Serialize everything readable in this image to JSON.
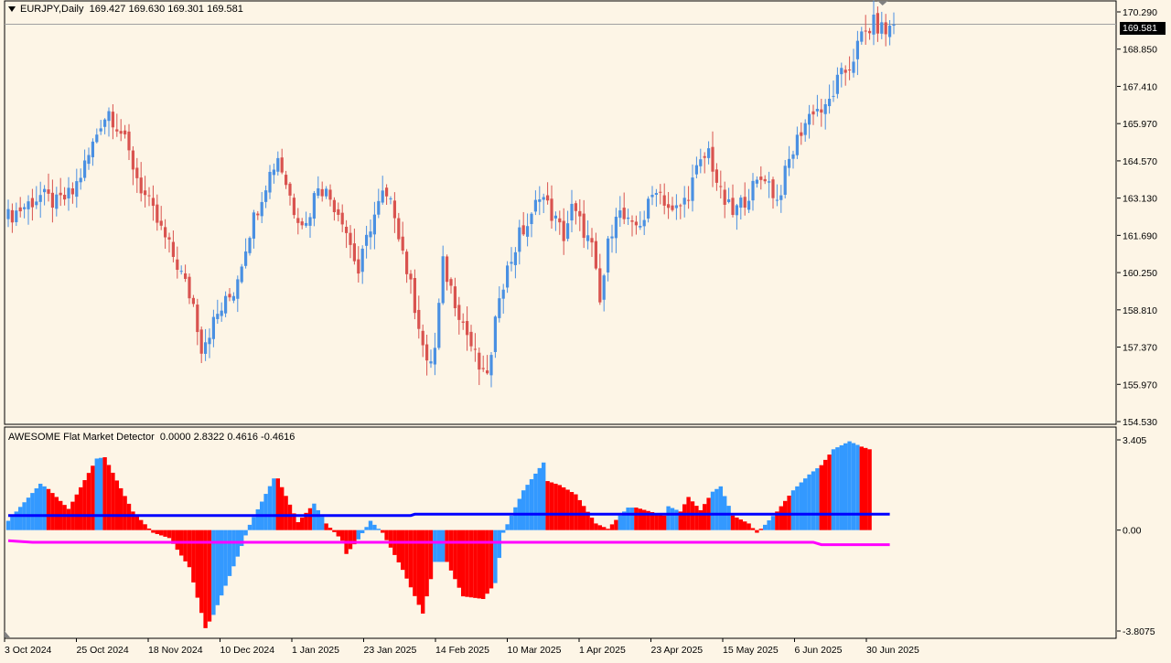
{
  "symbol_line": {
    "symbol": "EURJPY,Daily",
    "open": "169.427",
    "high": "169.630",
    "low": "169.301",
    "close": "169.581"
  },
  "indicator_line": {
    "name": "AWESOME Flat Market Detector",
    "v1": "0.0000",
    "v2": "2.8322",
    "v3": "0.4616",
    "v4": "-0.4616"
  },
  "price_tag": "169.581",
  "price_axis_labels": [
    "170.290",
    "168.850",
    "167.410",
    "165.970",
    "164.570",
    "163.130",
    "161.690",
    "160.250",
    "158.810",
    "157.370",
    "155.970",
    "154.530"
  ],
  "indicator_axis_labels": [
    "3.405",
    "0.00",
    "-3.8075"
  ],
  "date_labels": [
    "3 Oct 2024",
    "25 Oct 2024",
    "18 Nov 2024",
    "10 Dec 2024",
    "1 Jan 2025",
    "23 Jan 2025",
    "14 Feb 2025",
    "10 Mar 2025",
    "1 Apr 2025",
    "23 Apr 2025",
    "15 May 2025",
    "6 Jun 2025",
    "30 Jun 2025"
  ],
  "colors": {
    "background": "#fdf5e6",
    "bull_candle": "#4a90e2",
    "bear_candle": "#d9534f",
    "hist_blue": "#3399ff",
    "hist_red": "#ff0000",
    "upper_line": "#0000ff",
    "lower_line": "#ff00ff",
    "grid_line": "#a0a0a0"
  },
  "chart_data": [
    {
      "type": "candlestick",
      "title": "EURJPY,Daily",
      "ylim": [
        154.53,
        170.29
      ],
      "close_path": [
        [
          0,
          162.3
        ],
        [
          8,
          163.1
        ],
        [
          12,
          162.8
        ],
        [
          16,
          163.2
        ],
        [
          20,
          164.6
        ],
        [
          23,
          165.9
        ],
        [
          25,
          166.3
        ],
        [
          28,
          165.5
        ],
        [
          33,
          163.4
        ],
        [
          37,
          162.1
        ],
        [
          42,
          160.5
        ],
        [
          46,
          159.0
        ],
        [
          48,
          157.4
        ],
        [
          52,
          158.6
        ],
        [
          56,
          159.5
        ],
        [
          60,
          161.8
        ],
        [
          64,
          163.6
        ],
        [
          67,
          164.6
        ],
        [
          71,
          162.6
        ],
        [
          74,
          162.0
        ],
        [
          77,
          163.6
        ],
        [
          80,
          163.0
        ],
        [
          83,
          162.3
        ],
        [
          87,
          160.2
        ],
        [
          90,
          162.0
        ],
        [
          93,
          163.1
        ],
        [
          96,
          162.5
        ],
        [
          99,
          160.3
        ],
        [
          102,
          158.3
        ],
        [
          104,
          156.6
        ],
        [
          106,
          157.3
        ],
        [
          108,
          160.5
        ],
        [
          110,
          159.6
        ],
        [
          113,
          158.3
        ],
        [
          116,
          157.0
        ],
        [
          118,
          156.2
        ],
        [
          120,
          156.9
        ],
        [
          122,
          159.5
        ],
        [
          124,
          160.3
        ],
        [
          127,
          161.6
        ],
        [
          130,
          162.2
        ],
        [
          132,
          163.3
        ],
        [
          135,
          162.4
        ],
        [
          138,
          161.6
        ],
        [
          140,
          162.6
        ],
        [
          143,
          161.8
        ],
        [
          145,
          161.1
        ],
        [
          147,
          159.0
        ],
        [
          149,
          161.2
        ],
        [
          151,
          162.6
        ],
        [
          155,
          161.8
        ],
        [
          158,
          162.3
        ],
        [
          161,
          163.5
        ],
        [
          165,
          162.4
        ],
        [
          168,
          162.9
        ],
        [
          171,
          164.0
        ],
        [
          174,
          164.8
        ],
        [
          177,
          163.1
        ],
        [
          180,
          162.4
        ],
        [
          184,
          163.2
        ],
        [
          188,
          163.9
        ],
        [
          191,
          162.9
        ],
        [
          194,
          164.4
        ],
        [
          197,
          165.6
        ],
        [
          200,
          166.4
        ],
        [
          203,
          166.3
        ],
        [
          206,
          167.4
        ],
        [
          209,
          168.0
        ],
        [
          212,
          169.1
        ],
        [
          215,
          169.6
        ],
        [
          218,
          169.3
        ],
        [
          220,
          169.58
        ]
      ]
    },
    {
      "type": "bar",
      "title": "AWESOME Flat Market Detector",
      "ylim": [
        -3.8075,
        3.405
      ],
      "keys": [
        [
          0,
          0.35,
          "b"
        ],
        [
          8,
          1.75,
          "b"
        ],
        [
          10,
          1.55,
          "r"
        ],
        [
          15,
          0.8,
          "r"
        ],
        [
          22,
          2.7,
          "b"
        ],
        [
          24,
          2.75,
          "r"
        ],
        [
          31,
          0.7,
          "r"
        ],
        [
          36,
          -0.1,
          "r"
        ],
        [
          40,
          -0.3,
          "r"
        ],
        [
          45,
          -1.4,
          "r"
        ],
        [
          49,
          -3.7,
          "r"
        ],
        [
          51,
          -3.2,
          "b"
        ],
        [
          57,
          -1.0,
          "b"
        ],
        [
          60,
          0.2,
          "b"
        ],
        [
          66,
          1.95,
          "b"
        ],
        [
          67,
          1.95,
          "r"
        ],
        [
          72,
          0.3,
          "r"
        ],
        [
          76,
          1.0,
          "b"
        ],
        [
          79,
          0.25,
          "r"
        ],
        [
          83,
          -0.4,
          "r"
        ],
        [
          84,
          -0.9,
          "r"
        ],
        [
          87,
          -0.35,
          "b"
        ],
        [
          90,
          0.35,
          "b"
        ],
        [
          93,
          -0.1,
          "r"
        ],
        [
          98,
          -1.5,
          "r"
        ],
        [
          103,
          -3.15,
          "r"
        ],
        [
          106,
          -1.2,
          "b"
        ],
        [
          109,
          -1.2,
          "r"
        ],
        [
          113,
          -2.5,
          "r"
        ],
        [
          118,
          -2.6,
          "r"
        ],
        [
          121,
          -2.0,
          "b"
        ],
        [
          123,
          -0.1,
          "b"
        ],
        [
          128,
          1.5,
          "b"
        ],
        [
          133,
          2.55,
          "b"
        ],
        [
          134,
          1.85,
          "r"
        ],
        [
          137,
          1.7,
          "r"
        ],
        [
          141,
          1.35,
          "r"
        ],
        [
          146,
          0.25,
          "r"
        ],
        [
          149,
          0.05,
          "r"
        ],
        [
          152,
          0.55,
          "b"
        ],
        [
          154,
          0.85,
          "b"
        ],
        [
          156,
          0.85,
          "r"
        ],
        [
          163,
          0.55,
          "r"
        ],
        [
          164,
          0.9,
          "b"
        ],
        [
          167,
          0.7,
          "r"
        ],
        [
          169,
          1.25,
          "r"
        ],
        [
          172,
          0.75,
          "r"
        ],
        [
          175,
          1.45,
          "b"
        ],
        [
          177,
          1.65,
          "b"
        ],
        [
          180,
          0.55,
          "r"
        ],
        [
          184,
          0.25,
          "r"
        ],
        [
          186,
          -0.1,
          "r"
        ],
        [
          188,
          0.2,
          "b"
        ],
        [
          191,
          0.7,
          "r"
        ],
        [
          195,
          1.5,
          "b"
        ],
        [
          199,
          2.1,
          "b"
        ],
        [
          202,
          2.45,
          "r"
        ],
        [
          205,
          3.05,
          "b"
        ],
        [
          209,
          3.35,
          "b"
        ],
        [
          212,
          3.15,
          "r"
        ],
        [
          214,
          3.05,
          "r"
        ]
      ],
      "upper_line": [
        [
          0,
          0.55
        ],
        [
          100,
          0.55
        ],
        [
          101,
          0.6
        ],
        [
          219,
          0.6
        ]
      ],
      "lower_line": [
        [
          0,
          -0.4
        ],
        [
          6,
          -0.46
        ],
        [
          200,
          -0.46
        ],
        [
          202,
          -0.55
        ],
        [
          219,
          -0.55
        ]
      ]
    }
  ]
}
